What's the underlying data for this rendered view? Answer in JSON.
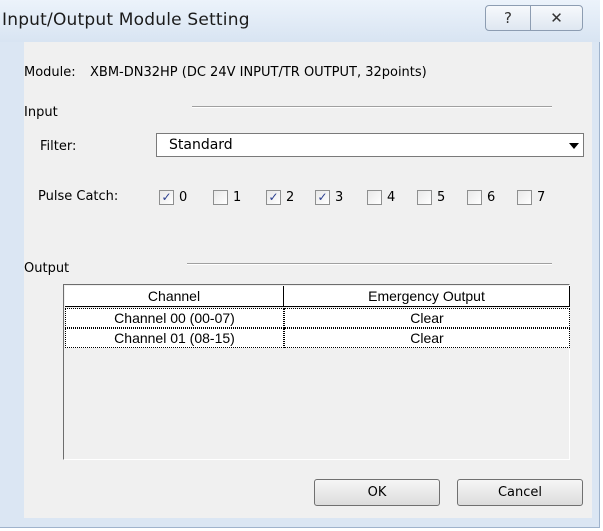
{
  "window": {
    "title": "Input/Output Module Setting",
    "help_icon": "?",
    "close_icon": "✕"
  },
  "module": {
    "label": "Module:",
    "value": "XBM-DN32HP (DC 24V INPUT/TR OUTPUT, 32points)"
  },
  "input": {
    "group_label": "Input",
    "filter_label": "Filter:",
    "filter_value": "Standard",
    "pulse_catch_label": "Pulse Catch:",
    "pulse_catch": [
      {
        "label": "0",
        "checked": true
      },
      {
        "label": "1",
        "checked": false
      },
      {
        "label": "2",
        "checked": true
      },
      {
        "label": "3",
        "checked": true
      },
      {
        "label": "4",
        "checked": false
      },
      {
        "label": "5",
        "checked": false
      },
      {
        "label": "6",
        "checked": false
      },
      {
        "label": "7",
        "checked": false
      }
    ]
  },
  "output": {
    "group_label": "Output",
    "columns": [
      "Channel",
      "Emergency Output"
    ],
    "rows": [
      {
        "channel": "Channel 00 (00-07)",
        "emergency": "Clear"
      },
      {
        "channel": "Channel 01 (08-15)",
        "emergency": "Clear"
      }
    ]
  },
  "buttons": {
    "ok": "OK",
    "cancel": "Cancel"
  },
  "colors": {
    "frame": "#dbe6f3",
    "client": "#f0f0f0",
    "check": "#2b3f8f"
  }
}
